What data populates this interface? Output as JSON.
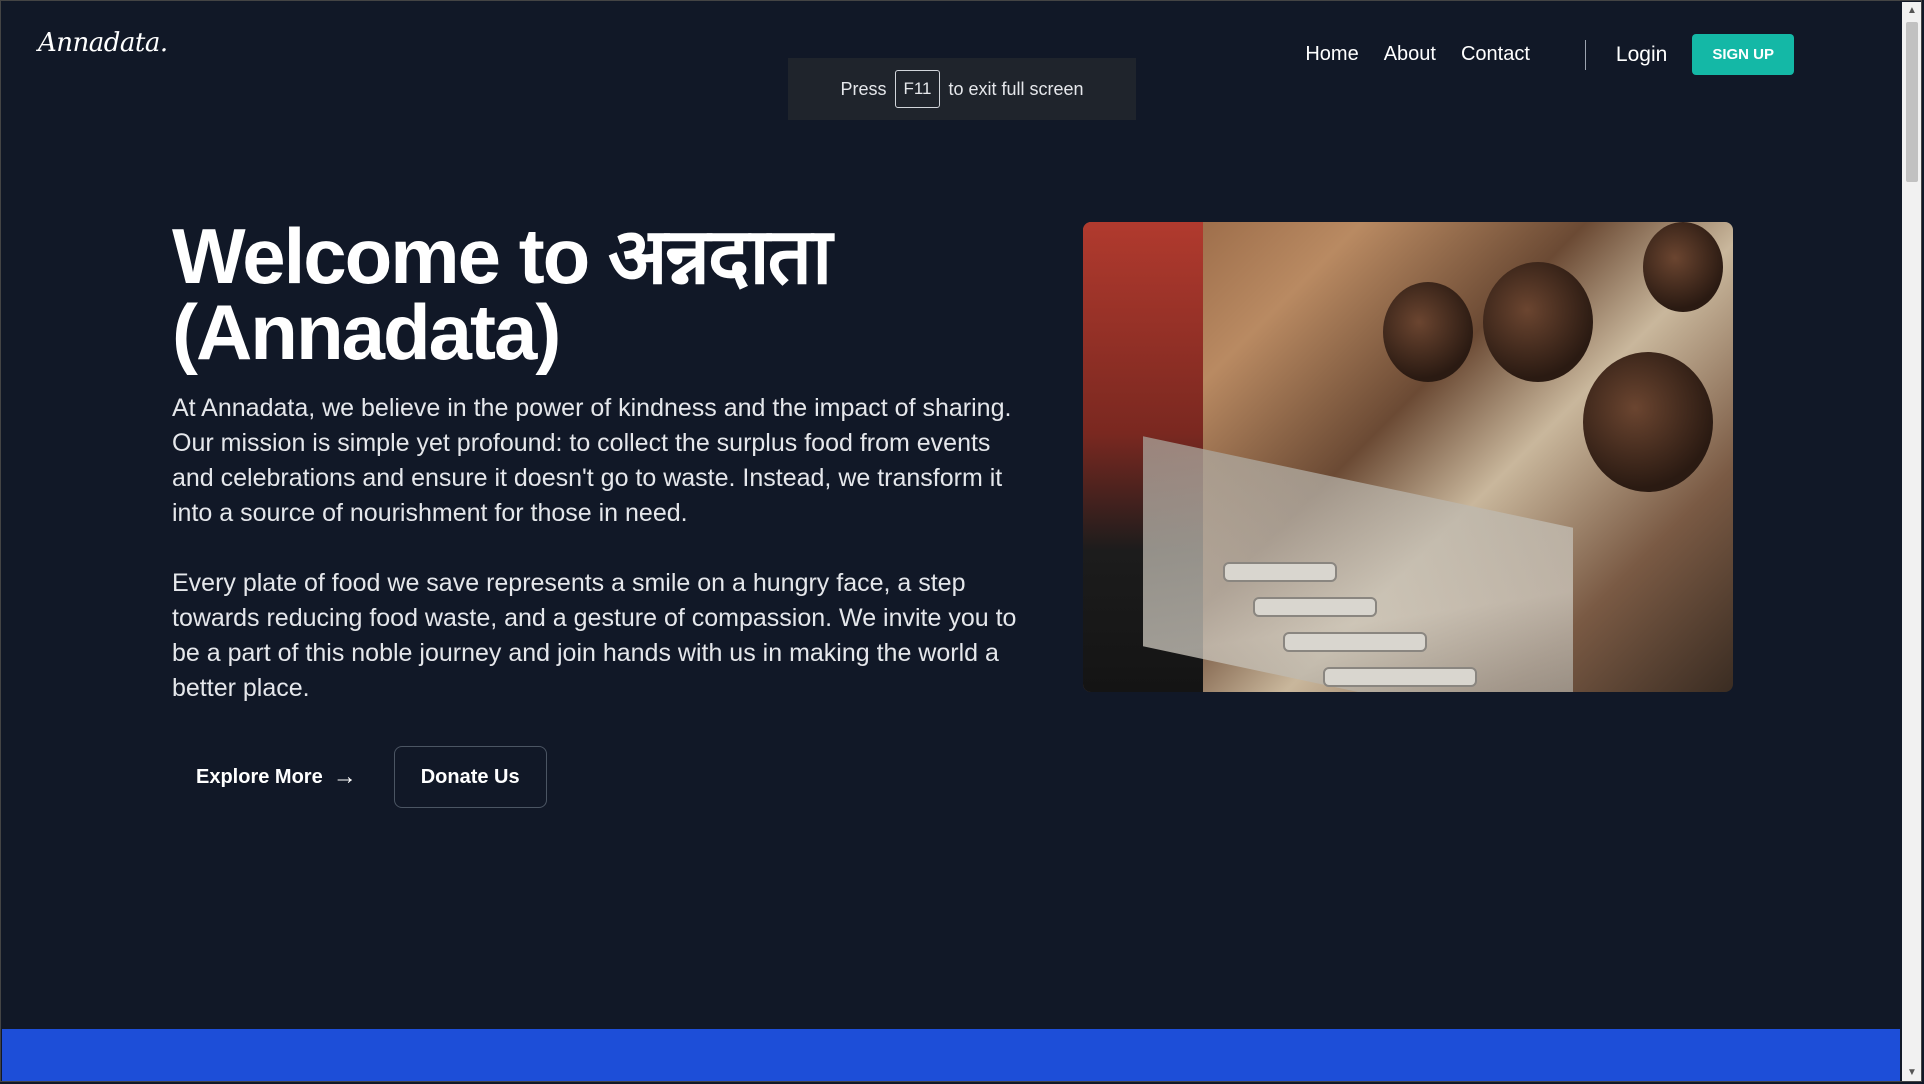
{
  "header": {
    "logo": "Annadata.",
    "nav": [
      "Home",
      "About",
      "Contact"
    ],
    "login": "Login",
    "signup": "SIGN UP"
  },
  "toast": {
    "prefix": "Press",
    "key": "F11",
    "suffix": "to exit full screen"
  },
  "hero": {
    "title_line1": "Welcome to अन्नदाता",
    "title_line2": "(Annadata)",
    "paragraph1": "At Annadata, we believe in the power of kindness and the impact of sharing. Our mission is simple yet profound: to collect the surplus food from events and celebrations and ensure it doesn't go to waste. Instead, we transform it into a source of nourishment for those in need.",
    "paragraph2": "Every plate of food we save represents a smile on a hungry face, a step towards reducing food waste, and a gesture of compassion. We invite you to be a part of this noble journey and join hands with us in making the world a better place.",
    "explore_label": "Explore More",
    "donate_label": "Donate Us"
  },
  "icons": {
    "explore_arrow": "arrow-right-icon",
    "scroll_up": "chevron-up-icon",
    "scroll_down": "chevron-down-icon"
  },
  "colors": {
    "background": "#111827",
    "signup_button": "#14b8a6",
    "footer_band": "#1d4ed8"
  }
}
